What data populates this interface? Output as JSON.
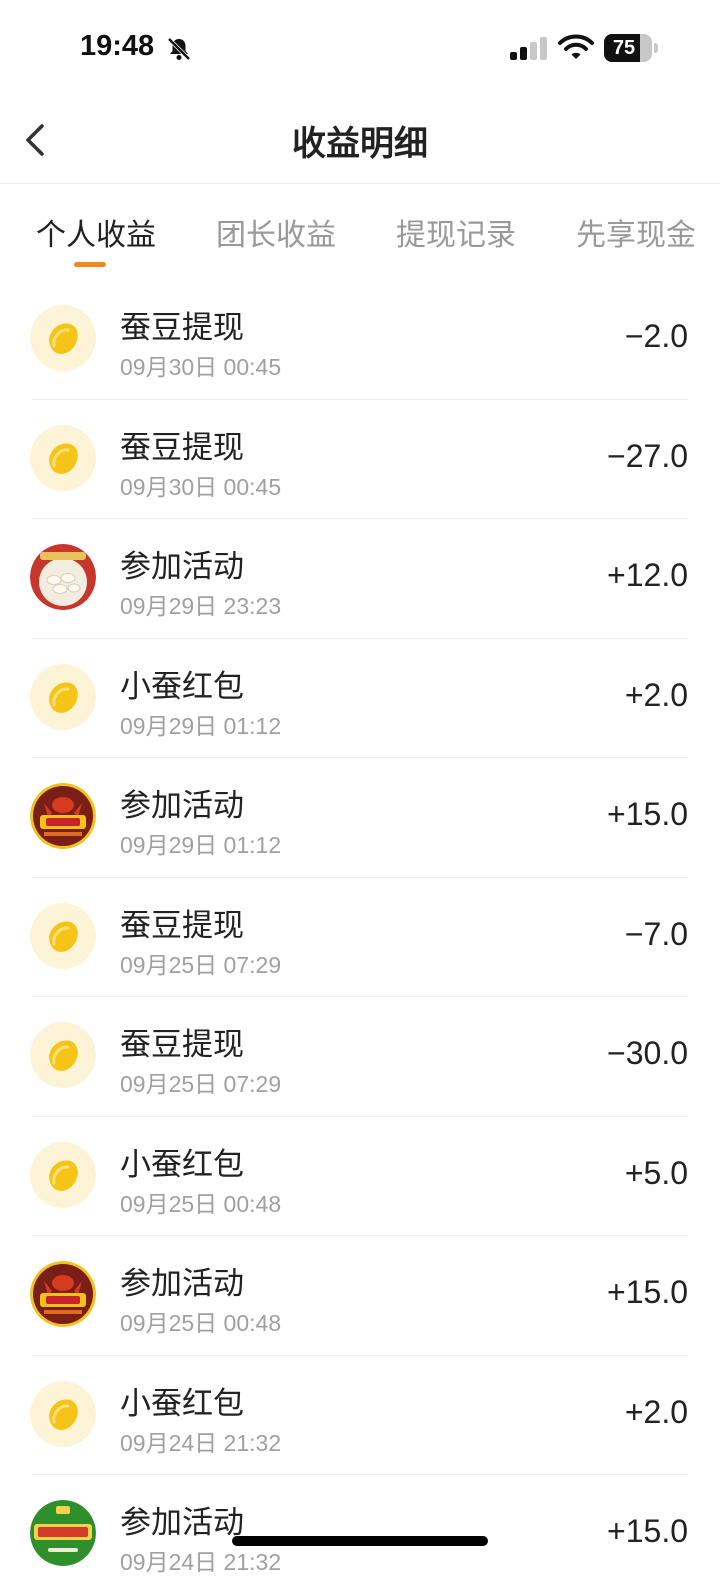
{
  "status_bar": {
    "time": "19:48",
    "battery": "75",
    "battery_level": 0.75,
    "icons": [
      "bell-slash-icon",
      "signal-icon",
      "wifi-icon",
      "battery-icon"
    ]
  },
  "header": {
    "title": "收益明细",
    "back_icon": "chevron-left-icon"
  },
  "tabs": [
    {
      "label": "个人收益",
      "active": true
    },
    {
      "label": "团长收益",
      "active": false
    },
    {
      "label": "提现记录",
      "active": false
    },
    {
      "label": "先享现金",
      "active": false
    }
  ],
  "colors": {
    "accent": "#f08a1c",
    "bean_bg": "#fdf3d6",
    "bean": "#f6c417"
  },
  "records": [
    {
      "title": "蚕豆提现",
      "time": "09月30日 00:45",
      "amount": "−2.0",
      "avatar": "bean"
    },
    {
      "title": "蚕豆提现",
      "time": "09月30日 00:45",
      "amount": "−27.0",
      "avatar": "bean"
    },
    {
      "title": "参加活动",
      "time": "09月29日 23:23",
      "amount": "+12.0",
      "avatar": "dumpling"
    },
    {
      "title": "小蚕红包",
      "time": "09月29日 01:12",
      "amount": "+2.0",
      "avatar": "bean"
    },
    {
      "title": "参加活动",
      "time": "09月29日 01:12",
      "amount": "+15.0",
      "avatar": "crayfish"
    },
    {
      "title": "蚕豆提现",
      "time": "09月25日 07:29",
      "amount": "−7.0",
      "avatar": "bean"
    },
    {
      "title": "蚕豆提现",
      "time": "09月25日 07:29",
      "amount": "−30.0",
      "avatar": "bean"
    },
    {
      "title": "小蚕红包",
      "time": "09月25日 00:48",
      "amount": "+5.0",
      "avatar": "bean"
    },
    {
      "title": "参加活动",
      "time": "09月25日 00:48",
      "amount": "+15.0",
      "avatar": "crayfish"
    },
    {
      "title": "小蚕红包",
      "time": "09月24日 21:32",
      "amount": "+2.0",
      "avatar": "bean"
    },
    {
      "title": "参加活动",
      "time": "09月24日 21:32",
      "amount": "+15.0",
      "avatar": "fruit"
    }
  ]
}
